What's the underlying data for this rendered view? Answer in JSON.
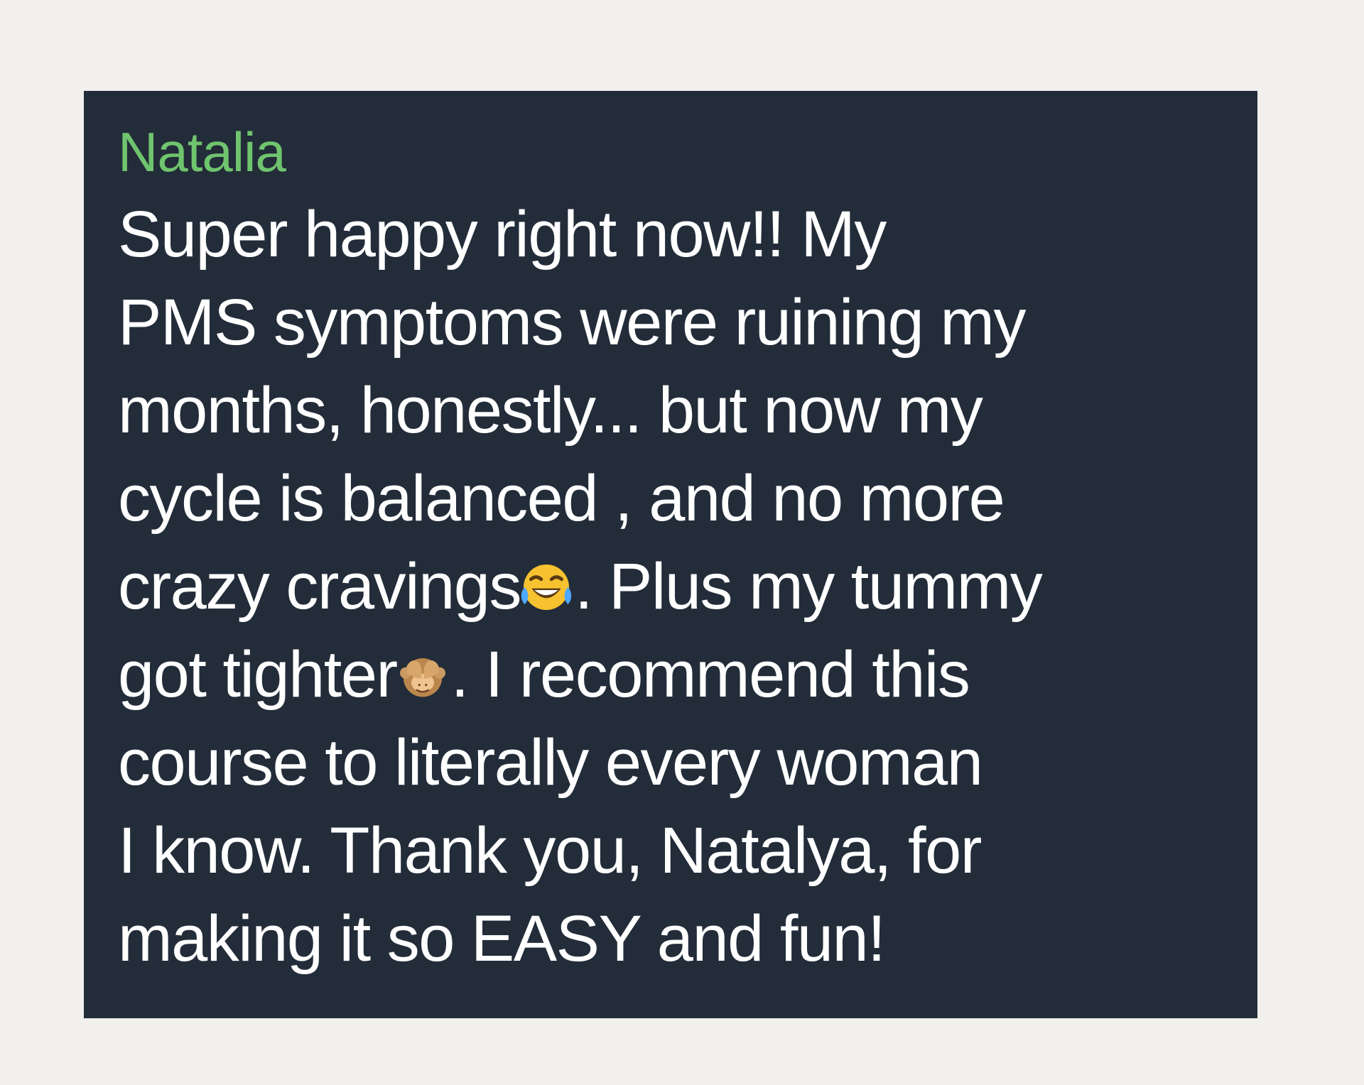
{
  "message": {
    "sender": "Natalia",
    "colors": {
      "sender_name": "#6fc46e",
      "bubble_background": "#232c39",
      "page_background": "#f1f0ec",
      "text": "#ffffff"
    },
    "lines": [
      "Super happy right now!!  My",
      "PMS symptoms were ruining my",
      "months, honestly... but now my",
      "cycle is balanced , and no more",
      "crazy cravings",
      ". Plus my tummy",
      "got tighter",
      ". I recommend this",
      "course to literally every woman",
      "I know. Thank you, Natalya, for",
      "making it so EASY and fun!"
    ],
    "emojis": {
      "tears_of_joy": "face-with-tears-of-joy-icon",
      "see_no_evil": "see-no-evil-monkey-icon"
    }
  }
}
